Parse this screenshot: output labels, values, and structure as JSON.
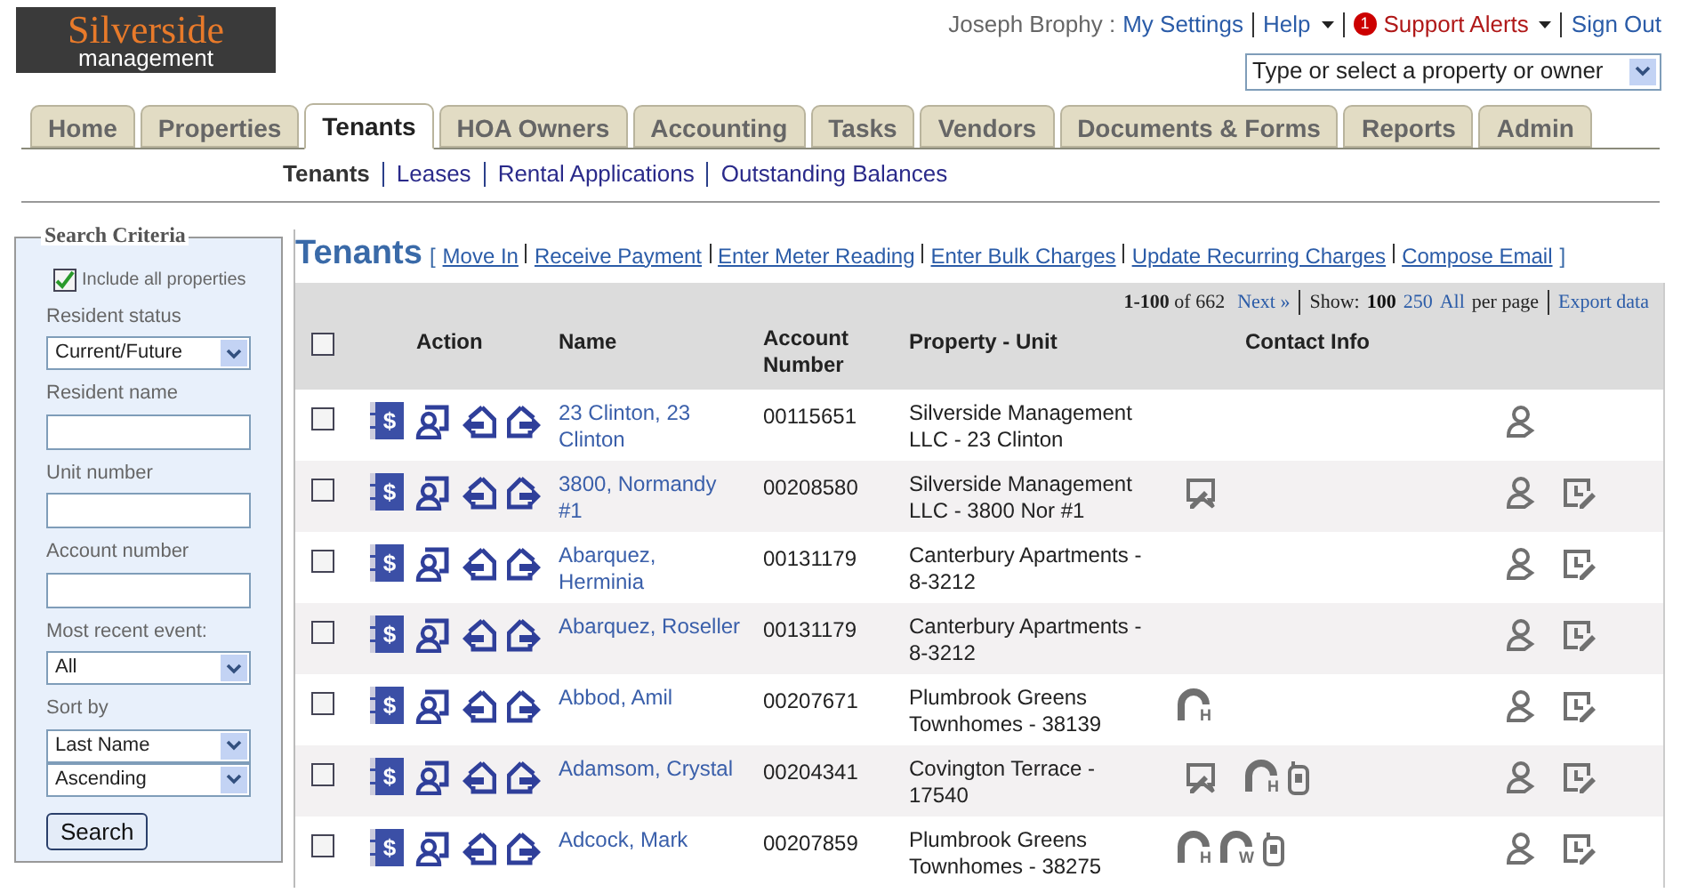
{
  "logo": {
    "line1": "Silverside",
    "line2": "management"
  },
  "user": {
    "name": "Joseph Brophy :",
    "links": [
      {
        "label": "My Settings",
        "kind": "link"
      },
      {
        "label": "Help",
        "kind": "menu"
      },
      {
        "label": "Support Alerts",
        "kind": "alert",
        "badge": "1"
      },
      {
        "label": "Sign Out",
        "kind": "link"
      }
    ]
  },
  "property_picker": {
    "placeholder": "Type or select a property or owner"
  },
  "tabs": [
    {
      "label": "Home",
      "selected": false
    },
    {
      "label": "Properties",
      "selected": false
    },
    {
      "label": "Tenants",
      "selected": true
    },
    {
      "label": "HOA Owners",
      "selected": false
    },
    {
      "label": "Accounting",
      "selected": false
    },
    {
      "label": "Tasks",
      "selected": false
    },
    {
      "label": "Vendors",
      "selected": false
    },
    {
      "label": "Documents & Forms",
      "selected": false
    },
    {
      "label": "Reports",
      "selected": false
    },
    {
      "label": "Admin",
      "selected": false
    }
  ],
  "subtabs": [
    {
      "label": "Tenants",
      "selected": true
    },
    {
      "label": "Leases",
      "selected": false
    },
    {
      "label": "Rental Applications",
      "selected": false
    },
    {
      "label": "Outstanding Balances",
      "selected": false
    }
  ],
  "search_criteria": {
    "title": "Search Criteria",
    "include_all": {
      "label": "Include all properties",
      "checked": true
    },
    "fields": [
      {
        "kind": "select",
        "label": "Resident status",
        "value": "Current/Future"
      },
      {
        "kind": "text",
        "label": "Resident name"
      },
      {
        "kind": "text",
        "label": "Unit number"
      },
      {
        "kind": "text",
        "label": "Account number"
      },
      {
        "kind": "select",
        "label": "Most recent event:",
        "value": "All"
      },
      {
        "kind": "select",
        "label": "Sort by",
        "value": "Last Name"
      },
      {
        "kind": "select",
        "value": "Ascending"
      }
    ],
    "button": "Search"
  },
  "page_title": "Tenants",
  "page_links": {
    "open": "[",
    "close": "]",
    "items": [
      "Move In",
      "Receive Payment",
      "Enter Meter Reading",
      "Enter Bulk Charges",
      "Update Recurring Charges",
      "Compose Email"
    ]
  },
  "pager": {
    "range": "1-100",
    "of": "of 662",
    "next": "Next »",
    "show": "Show:",
    "sizes": [
      {
        "label": "100",
        "selected": true
      },
      {
        "label": "250",
        "selected": false
      },
      {
        "label": "All",
        "selected": false
      }
    ],
    "per_page": "per page",
    "export": "Export data"
  },
  "table": {
    "select_all": {
      "checked": false
    },
    "columns": [
      "Action",
      "Name",
      "Account Number",
      "Property - Unit",
      "Contact Info"
    ],
    "rows": [
      {
        "checked": false,
        "symbol": "$",
        "name": "23 Clinton, 23 Clinton",
        "account": "00115651",
        "property": "Silverside Management LLC - 23 Clinton",
        "contacts": [],
        "history": false
      },
      {
        "checked": false,
        "symbol": "$",
        "name": "3800, Normandy #1",
        "account": "00208580",
        "property": "Silverside Management LLC - 3800 Nor #1",
        "contacts": [
          {
            "kind": "note"
          }
        ],
        "history": true
      },
      {
        "checked": false,
        "symbol": "$",
        "name": "Abarquez, Herminia",
        "account": "00131179",
        "property": "Canterbury Apartments - 8-3212",
        "contacts": [],
        "history": true
      },
      {
        "checked": false,
        "symbol": "$",
        "name": "Abarquez, Roseller",
        "account": "00131179",
        "property": "Canterbury Apartments - 8-3212",
        "contacts": [],
        "history": true
      },
      {
        "checked": false,
        "symbol": "$",
        "name": "Abbod, Amil",
        "account": "00207671",
        "property": "Plumbrook Greens Townhomes - 38139",
        "contacts": [
          {
            "kind": "phone",
            "letter": "H"
          }
        ],
        "history": true
      },
      {
        "checked": false,
        "symbol": "$",
        "name": "Adamsom, Crystal",
        "account": "00204341",
        "property": "Covington Terrace - 17540",
        "contacts": [
          {
            "kind": "note"
          },
          {
            "kind": "phone",
            "letter": "H"
          },
          {
            "kind": "mobile"
          }
        ],
        "history": true
      },
      {
        "checked": false,
        "symbol": "$",
        "name": "Adcock, Mark",
        "account": "00207859",
        "property": "Plumbrook Greens Townhomes - 38275",
        "contacts": [
          {
            "kind": "phone",
            "letter": "H"
          },
          {
            "kind": "phone",
            "letter": "W"
          },
          {
            "kind": "mobile"
          }
        ],
        "history": true
      }
    ]
  }
}
